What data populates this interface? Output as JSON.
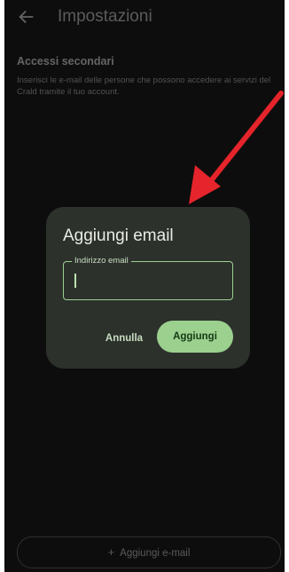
{
  "header": {
    "title": "Impostazioni",
    "back_icon": "arrow-left-icon"
  },
  "section": {
    "title": "Accessi secondari",
    "description": "Inserisci le e-mail delle persone che possono accedere ai servizi del Crald tramite il tuo account."
  },
  "dialog": {
    "title": "Aggiungi email",
    "field": {
      "label": "Indirizzo email",
      "value": ""
    },
    "cancel_label": "Annulla",
    "confirm_label": "Aggiungi"
  },
  "bottom": {
    "add_label": "Aggiungi e-mail",
    "icon": "plus-icon"
  },
  "colors": {
    "background": "#141414",
    "dialog": "#2d312c",
    "accent": "#9bd08f",
    "annotation_arrow": "#e5242b"
  }
}
